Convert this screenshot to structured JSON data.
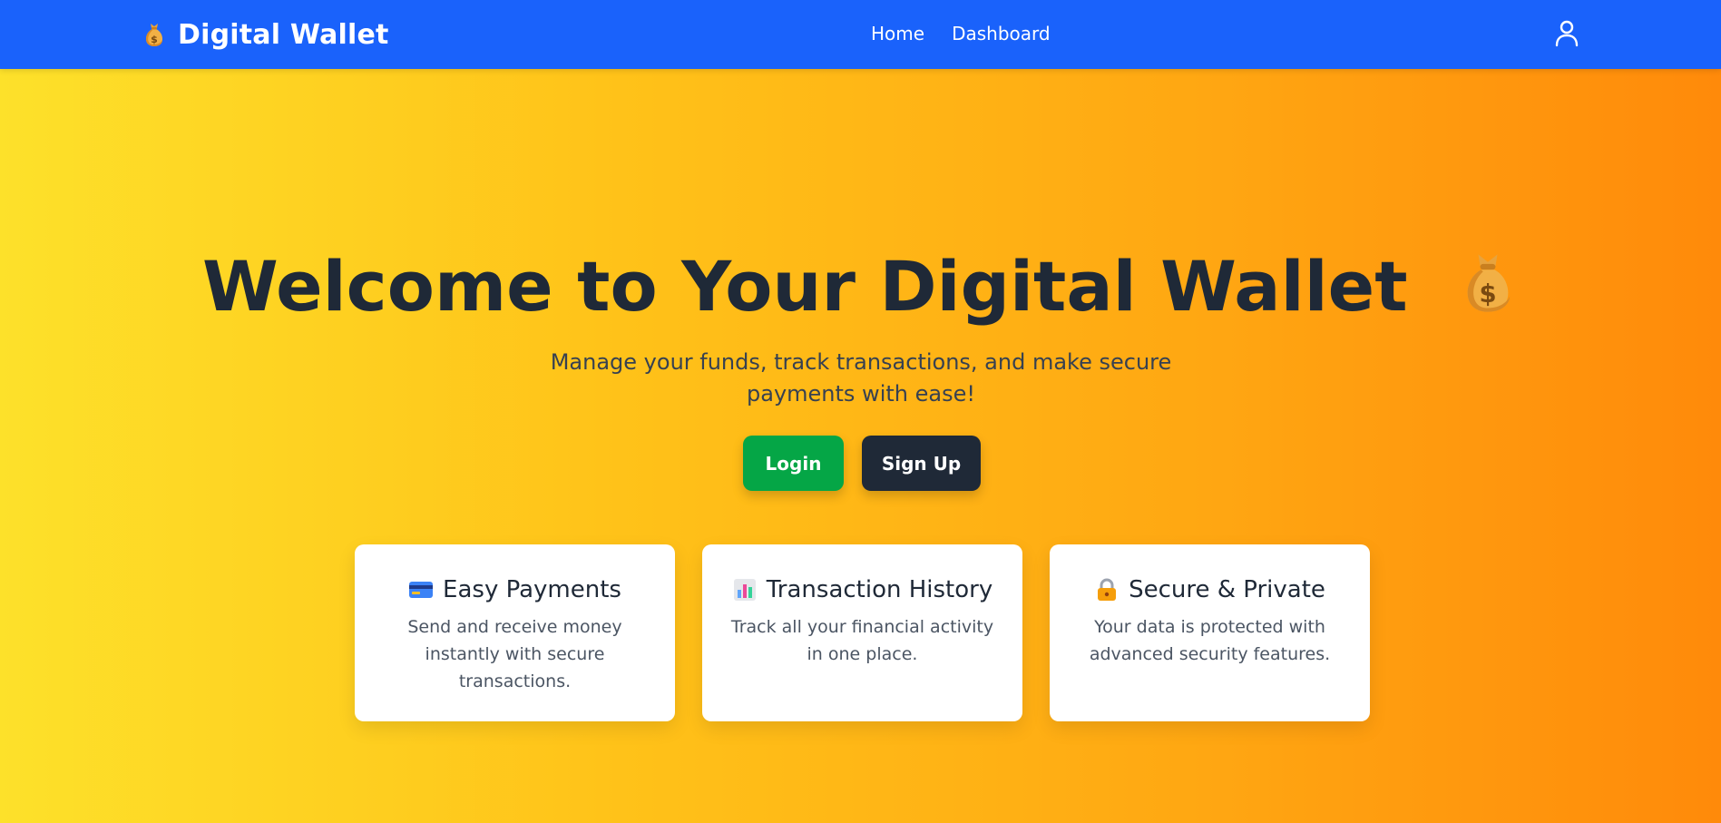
{
  "header": {
    "brand": "Digital Wallet",
    "brand_icon": "money-bag-icon",
    "nav": [
      {
        "label": "Home"
      },
      {
        "label": "Dashboard"
      }
    ],
    "user_icon": "user-icon"
  },
  "hero": {
    "title": "Welcome to Your Digital Wallet",
    "title_icon": "money-bag-icon",
    "subtitle": "Manage your funds, track transactions, and make secure payments with ease!",
    "login_label": "Login",
    "signup_label": "Sign Up"
  },
  "features": [
    {
      "icon": "credit-card-icon",
      "title": "Easy Payments",
      "description": "Send and receive money instantly with secure transactions."
    },
    {
      "icon": "bar-chart-icon",
      "title": "Transaction History",
      "description": "Track all your financial activity in one place."
    },
    {
      "icon": "lock-icon",
      "title": "Secure & Private",
      "description": "Your data is protected with advanced security features."
    }
  ],
  "colors": {
    "navbar": "#1a62fb",
    "gradient_start": "#fde12a",
    "gradient_end": "#ff8a0a",
    "login_button": "#05a646",
    "signup_button": "#1f2937",
    "heading_text": "#1f2937"
  }
}
